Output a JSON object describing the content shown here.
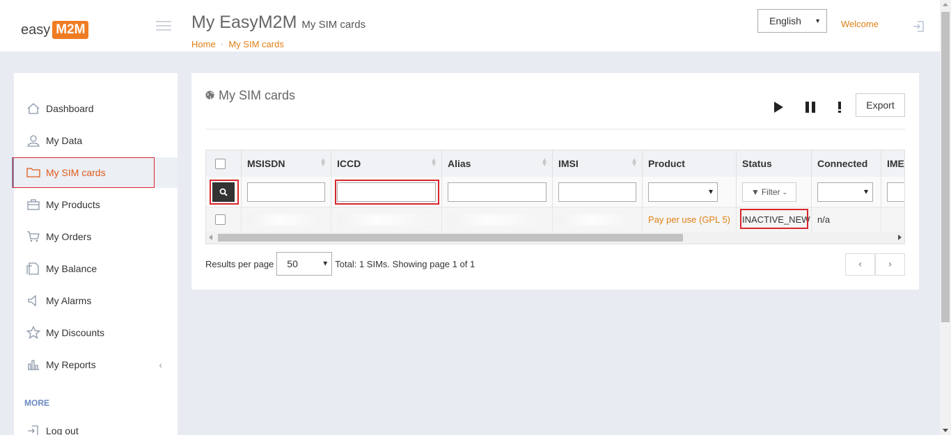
{
  "app": {
    "logo_easy": "easy",
    "logo_m2m": "M2M",
    "title": "My EasyM2M",
    "subtitle": "My SIM cards",
    "breadcrumb": [
      "Home",
      "My SIM cards"
    ],
    "language": "English",
    "welcome": "Welcome",
    "brand_color": "#f07c22",
    "link_color": "#e07f13"
  },
  "sidebar": {
    "items": [
      {
        "label": "Dashboard",
        "icon": "home-icon"
      },
      {
        "label": "My Data",
        "icon": "user-icon"
      },
      {
        "label": "My SIM cards",
        "icon": "folder-icon",
        "active": true
      },
      {
        "label": "My Products",
        "icon": "briefcase-icon"
      },
      {
        "label": "My Orders",
        "icon": "cart-icon"
      },
      {
        "label": "My Balance",
        "icon": "document-icon"
      },
      {
        "label": "My Alarms",
        "icon": "speaker-icon"
      },
      {
        "label": "My Discounts",
        "icon": "star-icon"
      },
      {
        "label": "My Reports",
        "icon": "bar-chart-icon"
      }
    ],
    "more_label": "MORE",
    "logout_label": "Log out"
  },
  "panel": {
    "title": "My SIM cards",
    "export_label": "Export",
    "columns": [
      "MSISDN",
      "ICCD",
      "Alias",
      "IMSI",
      "Product",
      "Status",
      "Connected",
      "IME"
    ],
    "filter_label": "Filter",
    "rows": [
      {
        "product": "Pay per use (GPL 5)",
        "status": "INACTIVE_NEW",
        "connected": "n/a"
      }
    ],
    "results_per_page_label": "Results per page",
    "results_per_page": "50",
    "total_text": "Total: 1 SIMs. Showing page 1 of 1",
    "pager_prev": "‹",
    "pager_next": "›"
  }
}
